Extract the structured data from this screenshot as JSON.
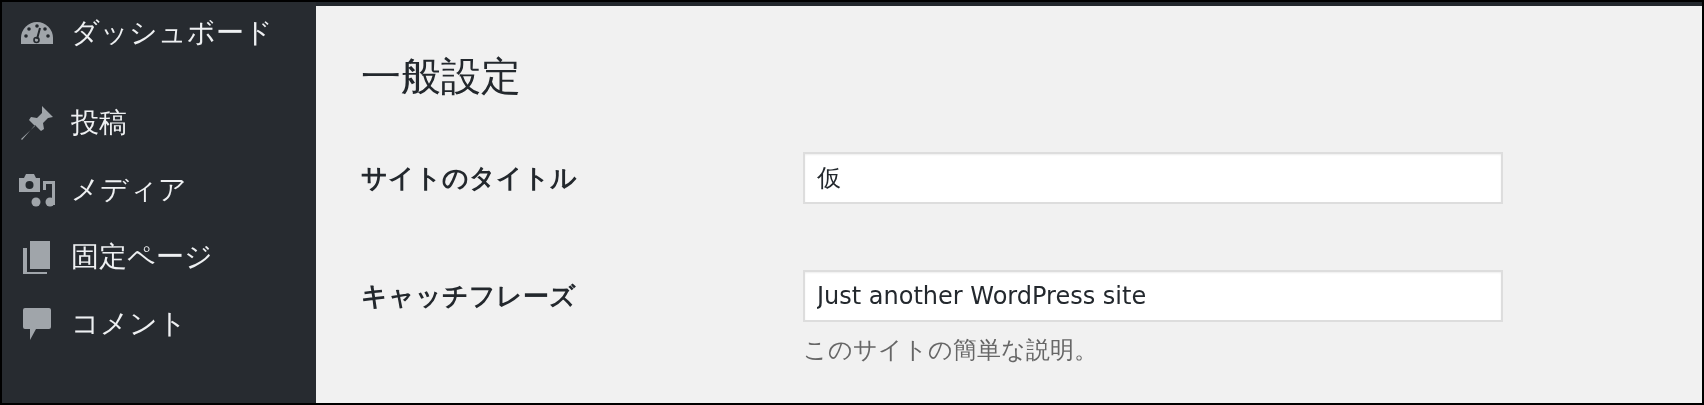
{
  "sidebar": {
    "items": [
      {
        "kind": "dashboard",
        "label": "ダッシュボード"
      },
      {
        "kind": "posts",
        "label": "投稿"
      },
      {
        "kind": "media",
        "label": "メディア"
      },
      {
        "kind": "pages",
        "label": "固定ページ"
      },
      {
        "kind": "comments",
        "label": "コメント"
      }
    ]
  },
  "page_title": "一般設定",
  "settings": [
    {
      "label": "サイトのタイトル",
      "value": "仮"
    },
    {
      "label": "キャッチフレーズ",
      "value": "Just another WordPress site",
      "description": "このサイトの簡単な説明。"
    }
  ]
}
